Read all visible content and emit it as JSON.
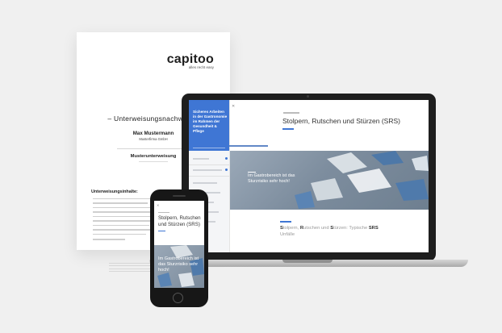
{
  "certificate": {
    "logo": "capitoo",
    "logo_tagline": "alles recht easy",
    "title": "– Unterweisungsnachweis –",
    "name": "Max Mustermann",
    "company": "Musterfirma GmbH",
    "course": "Musterunterweisung",
    "contents_heading": "Unterweisungsinhalte:"
  },
  "laptop": {
    "sidebar_title": "Sicheres Arbeiten in der Gastronomie im Rahmen der Gesundheit & Pflege",
    "close_icon": "close-icon",
    "lesson_title": "Stolpern, Rutschen und Stürzen (SRS)",
    "hero_text": "Im Gastrobereich ist das Sturzrisiko sehr hoch!",
    "sub_s": "S",
    "sub_1": "tolpern, ",
    "sub_r": "R",
    "sub_2": "utschen und ",
    "sub_s2": "S",
    "sub_3": "türzen: Typische ",
    "sub_srs": "SRS",
    "sub_4": "Unfälle"
  },
  "phone": {
    "lesson_title": "Stolpern, Rutschen und Stürzen (SRS)",
    "hero_text": "Im Gastrobereich ist das Sturzrisiko sehr hoch!"
  },
  "colors": {
    "accent": "#3f76d4",
    "background": "#f0f0f0"
  }
}
